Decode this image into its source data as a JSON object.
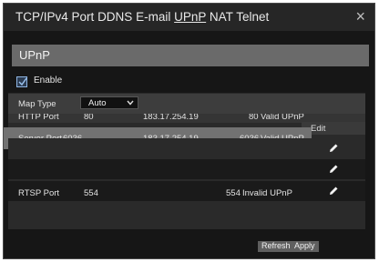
{
  "tabs": {
    "tcpip": "TCP/IPv4",
    "port": "Port",
    "ddns": "DDNS",
    "email": "E-mail",
    "upnp": "UPnP",
    "nat": "NAT",
    "telnet": "Telnet"
  },
  "close_glyph": "×",
  "section_title": "UPnP",
  "enable": {
    "label": "Enable",
    "checked": true
  },
  "map_type": {
    "label": "Map Type",
    "value": "Auto"
  },
  "edit_column": "Edit",
  "rows": [
    {
      "name": "HTTP Port",
      "port": "80",
      "ip": "183.17.254.19",
      "ext_port": "80",
      "status": "Valid UPnP"
    },
    {
      "name": "Server Port",
      "port": "6036",
      "ip": "183.17.254.19",
      "ext_port": "6036",
      "status": "Valid UPnP"
    },
    {
      "name": "RTSP Port",
      "port": "554",
      "ip": "",
      "ext_port": "554",
      "status": "Invalid UPnP"
    }
  ],
  "buttons": {
    "refresh": "Refresh",
    "apply": "Apply"
  },
  "colors": {
    "dialog_bg": "#161616",
    "section_bg": "#6a6a6a",
    "highlight_row": "#727272",
    "checkbox_border": "#8fb6e4"
  }
}
